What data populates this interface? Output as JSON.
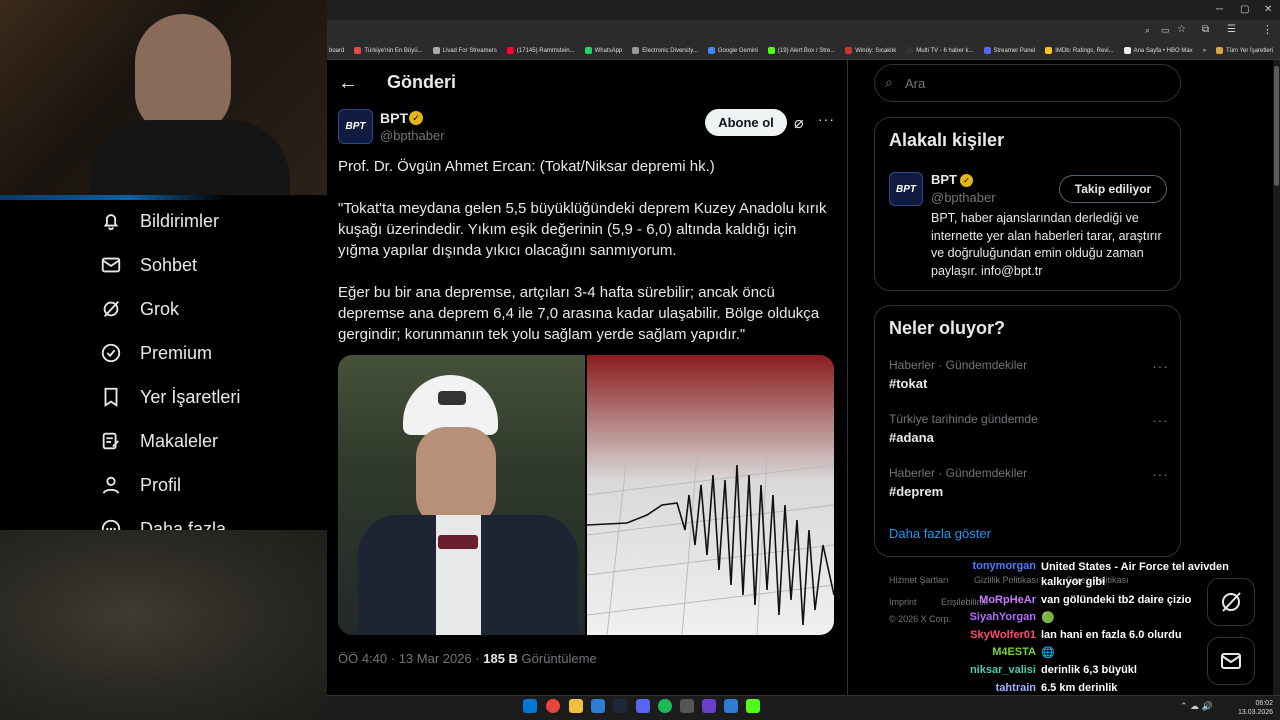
{
  "browser": {
    "bookmarks": [
      "board",
      "Türkiye'nin En Büyü...",
      "Livad For Streamers",
      "(17145) Rammstein...",
      "WhatsApp",
      "Electronic Diversity...",
      "Google Gemini",
      "(19) Alert Box / Stre...",
      "Windy: Sıcaklık",
      "Multi TV - 6 haber k...",
      "Streamer Panel",
      "IMDb: Ratings, Revi...",
      "Ana Sayfa • HBO Max"
    ],
    "all_bookmarks": "Tüm Yer İşaretleri",
    "more": "»"
  },
  "nav": {
    "items": [
      {
        "label": "Bildirimler",
        "icon": "bell-icon"
      },
      {
        "label": "Sohbet",
        "icon": "mail-icon"
      },
      {
        "label": "Grok",
        "icon": "grok-icon"
      },
      {
        "label": "Premium",
        "icon": "verified-icon"
      },
      {
        "label": "Yer İşaretleri",
        "icon": "bookmark-icon"
      },
      {
        "label": "Makaleler",
        "icon": "article-icon"
      },
      {
        "label": "Profil",
        "icon": "profile-icon"
      },
      {
        "label": "Daha fazla",
        "icon": "more-icon"
      }
    ]
  },
  "post": {
    "header_title": "Gönderi",
    "author_name": "BPT",
    "author_handle": "@bpthaber",
    "avatar_text": "BPT",
    "subscribe_label": "Abone ol",
    "body": [
      "Prof. Dr. Övgün Ahmet Ercan: (Tokat/Niksar depremi hk.)",
      "\"Tokat'ta meydana gelen 5,5 büyüklüğündeki deprem Kuzey Anadolu kırık kuşağı üzerindedir. Yıkım eşik değerinin (5,9 - 6,0) altında kaldığı için yığma yapılar dışında yıkıcı olacağını sanmıyorum.",
      "Eğer bu bir ana depremse, artçıları 3-4 hafta sürebilir; ancak öncü depremse ana deprem 6,4 ile 7,0 arasına kadar ulaşabilir. Bölge oldukça gergindir; korunmanın tek yolu sağlam yerde sağlam yapıdır.\""
    ],
    "timestamp": "ÖÖ 4:40 · 13 Mar 2026 · ",
    "views_count": "185 B",
    "views_label": " Görüntüleme"
  },
  "sidebar": {
    "search_placeholder": "Ara",
    "related_title": "Alakalı kişiler",
    "related": {
      "name": "BPT",
      "handle": "@bpthaber",
      "follow_label": "Takip ediliyor",
      "bio": "BPT, haber ajanslarından derlediği ve internette yer alan haberleri tarar, araştırır ve doğruluğundan emin olduğu zaman paylaşır. info@bpt.tr"
    },
    "trends_title": "Neler oluyor?",
    "trends": [
      {
        "category": "Haberler · Gündemdekiler",
        "tag": "#tokat"
      },
      {
        "category": "Türkiye tarihinde gündemde",
        "tag": "#adana"
      },
      {
        "category": "Haberler · Gündemdekiler",
        "tag": "#deprem"
      }
    ],
    "show_more": "Daha fazla göster",
    "footer": [
      "Hizmet Şartları",
      "Gizlilik Politikası",
      "Çerez Politikası",
      "Imprint",
      "Erişilebilirlik",
      "© 2026 X Corp."
    ]
  },
  "chat": [
    {
      "user": "tonymorgan",
      "color": "#4a7cff",
      "msg": "United States - Air Force tel avivden kalkıyor gibi"
    },
    {
      "user": "MoRpHeAr",
      "color": "#c77dff",
      "msg": "van gölündeki tb2 daire çizio"
    },
    {
      "user": "SiyahYorgan",
      "color": "#b36bff",
      "msg": "🟢"
    },
    {
      "user": "SkyWolfer01",
      "color": "#ff4d6d",
      "msg": "lan hani en fazla 6.0 olurdu"
    },
    {
      "user": "M4ESTA",
      "color": "#7bd34a",
      "msg": "🌐"
    },
    {
      "user": "niksar_valisi",
      "color": "#4ec9b0",
      "msg": "derinlik 6,3 büyükl"
    },
    {
      "user": "tahtrain",
      "color": "#9fb4ff",
      "msg": "6.5 km derinlik"
    }
  ],
  "taskbar": {
    "time": "06:02",
    "date": "13.03.2026"
  }
}
